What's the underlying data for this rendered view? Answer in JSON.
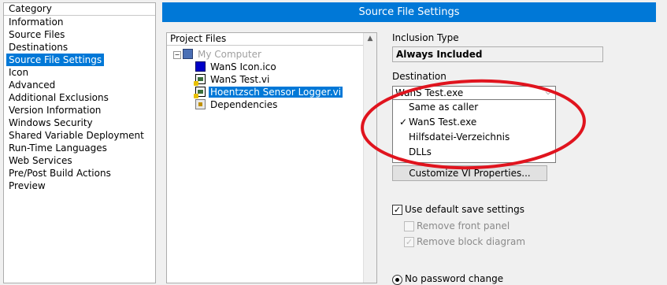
{
  "category": {
    "header": "Category",
    "items": [
      "Information",
      "Source Files",
      "Destinations",
      "Source File Settings",
      "Icon",
      "Advanced",
      "Additional Exclusions",
      "Version Information",
      "Windows Security",
      "Shared Variable Deployment",
      "Run-Time Languages",
      "Web Services",
      "Pre/Post Build Actions",
      "Preview"
    ],
    "selected_index": 3
  },
  "title_bar": "Source File Settings",
  "project_files": {
    "header": "Project Files",
    "toggle": "−",
    "root": "My Computer",
    "items": [
      "WanS Icon.ico",
      "WanS Test.vi",
      "Hoentzsch Sensor Logger.vi"
    ],
    "dependencies": "Dependencies",
    "selected": "Hoentzsch Sensor Logger.vi"
  },
  "inclusion_type": {
    "label": "Inclusion Type",
    "value": "Always Included"
  },
  "destination": {
    "label": "Destination",
    "value": "WanS Test.exe",
    "options": [
      {
        "label": "Same as caller",
        "checked": false
      },
      {
        "label": "WanS Test.exe",
        "checked": true
      },
      {
        "label": "Hilfsdatei-Verzeichnis",
        "checked": false
      },
      {
        "label": "DLLs",
        "checked": false
      }
    ],
    "check_glyph": "✓",
    "arrow_glyph": "⌵"
  },
  "customize_button": "Customize VI Properties...",
  "save_settings": {
    "use_default": {
      "label": "Use default save settings",
      "checked": true
    },
    "remove_front_panel": {
      "label": "Remove front panel",
      "checked": false
    },
    "remove_block_diagram": {
      "label": "Remove block diagram",
      "checked": true
    },
    "check_glyph": "✓"
  },
  "password": {
    "no_change_label": "No password change"
  },
  "annotation_color": "#e0141e"
}
